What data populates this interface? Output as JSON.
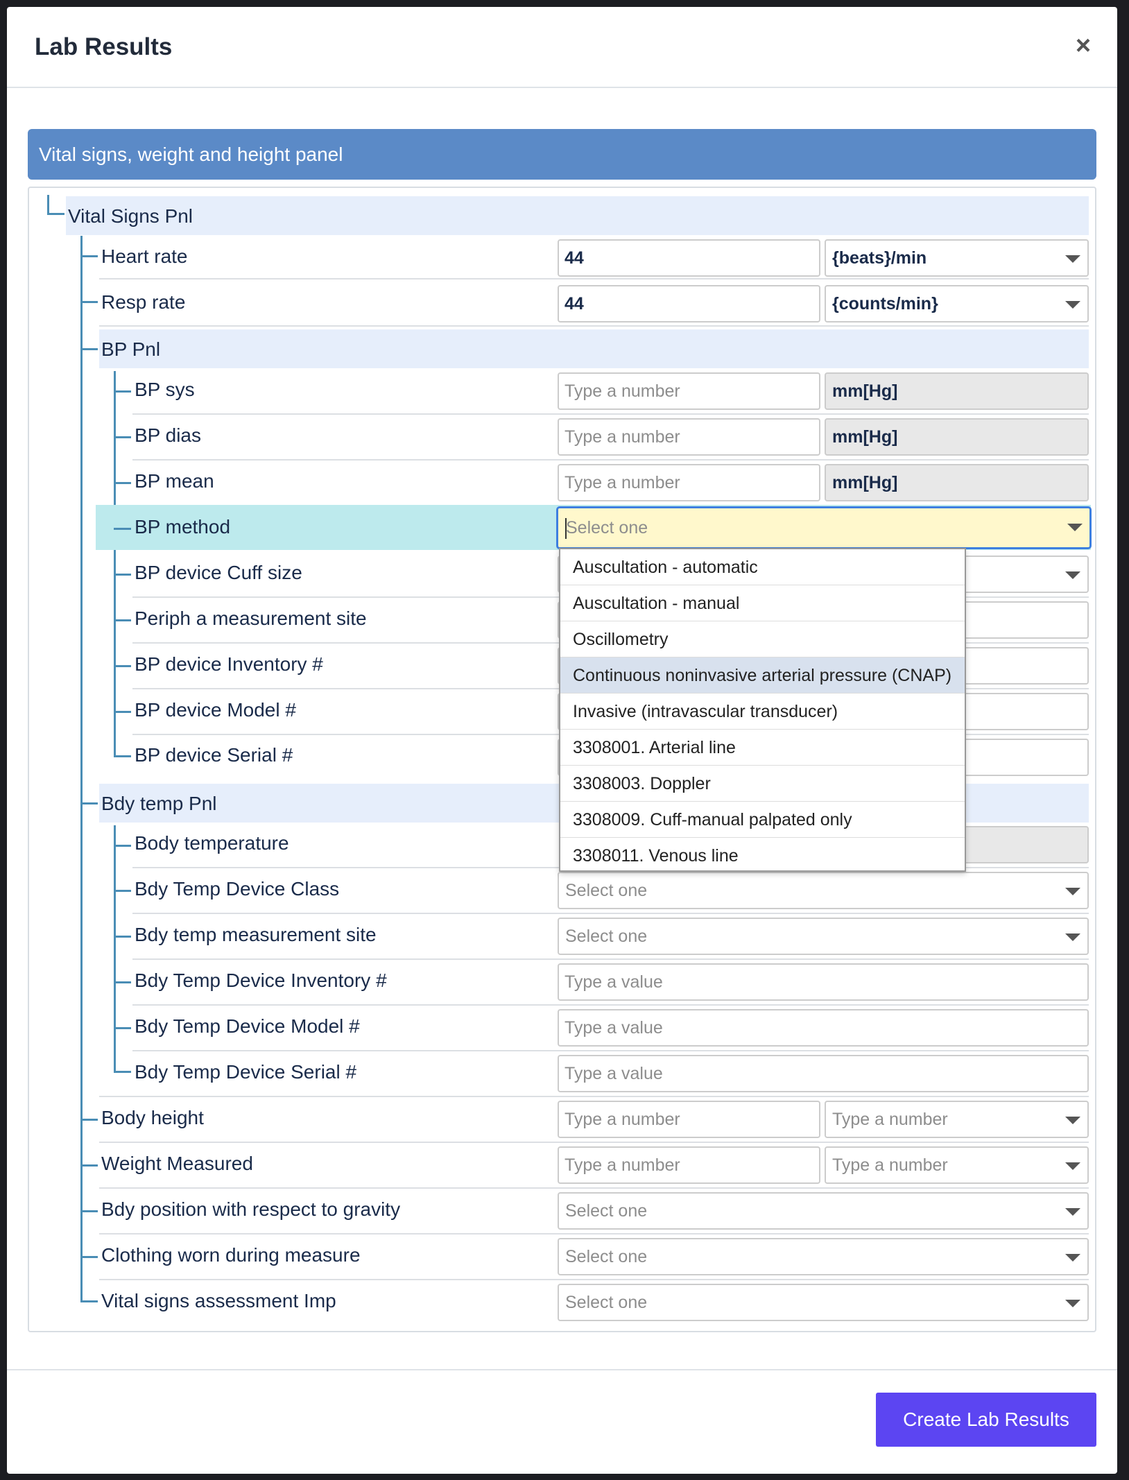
{
  "modal": {
    "title": "Lab Results",
    "close_label": "×"
  },
  "panel": {
    "title": "Vital signs, weight and height panel"
  },
  "tree": {
    "vital_signs_pnl": "Vital Signs Pnl",
    "heart_rate": {
      "label": "Heart rate",
      "value": "44",
      "unit": "{beats}/min"
    },
    "resp_rate": {
      "label": "Resp rate",
      "value": "44",
      "unit": "{counts/min}"
    },
    "bp_pnl": "BP Pnl",
    "bp_sys": {
      "label": "BP sys",
      "placeholder": "Type a number",
      "unit": "mm[Hg]"
    },
    "bp_dias": {
      "label": "BP dias",
      "placeholder": "Type a number",
      "unit": "mm[Hg]"
    },
    "bp_mean": {
      "label": "BP mean",
      "placeholder": "Type a number",
      "unit": "mm[Hg]"
    },
    "bp_method": {
      "label": "BP method",
      "placeholder": "Select one"
    },
    "bp_cuff": {
      "label": "BP device Cuff size"
    },
    "periph_site": {
      "label": "Periph a measurement site"
    },
    "bp_inventory": {
      "label": "BP device Inventory #"
    },
    "bp_model": {
      "label": "BP device Model #"
    },
    "bp_serial": {
      "label": "BP device Serial #"
    },
    "bdy_temp_pnl": "Bdy temp Pnl",
    "body_temp": {
      "label": "Body temperature"
    },
    "temp_class": {
      "label": "Bdy Temp Device Class",
      "placeholder": "Select one"
    },
    "temp_site": {
      "label": "Bdy temp measurement site",
      "placeholder": "Select one"
    },
    "temp_inventory": {
      "label": "Bdy Temp Device Inventory #",
      "placeholder": "Type a value"
    },
    "temp_model": {
      "label": "Bdy Temp Device Model #",
      "placeholder": "Type a value"
    },
    "temp_serial": {
      "label": "Bdy Temp Device Serial #",
      "placeholder": "Type a value"
    },
    "body_height": {
      "label": "Body height",
      "placeholder": "Type a number",
      "unit_placeholder": "Type a number"
    },
    "weight": {
      "label": "Weight Measured",
      "placeholder": "Type a number",
      "unit_placeholder": "Type a number"
    },
    "position": {
      "label": "Bdy position with respect to gravity",
      "placeholder": "Select one"
    },
    "clothing": {
      "label": "Clothing worn during measure",
      "placeholder": "Select one"
    },
    "assessment": {
      "label": "Vital signs assessment Imp",
      "placeholder": "Select one"
    }
  },
  "dropdown": {
    "options": [
      "Auscultation - automatic",
      "Auscultation - manual",
      "Oscillometry",
      "Continuous noninvasive arterial pressure (CNAP)",
      "Invasive (intravascular transducer)",
      "3308001. Arterial line",
      "3308003. Doppler",
      "3308009. Cuff-manual palpated only",
      "3308011. Venous line"
    ],
    "highlighted_index": 3
  },
  "footer": {
    "create_button": "Create Lab Results"
  },
  "colors": {
    "accent": "#5c45f2",
    "panel_header": "#5b8ac7",
    "tree_line": "#4a8db5",
    "group_bg": "#e6eefb",
    "row_highlight": "#bdeaed",
    "active_field": "#fff8cc"
  }
}
